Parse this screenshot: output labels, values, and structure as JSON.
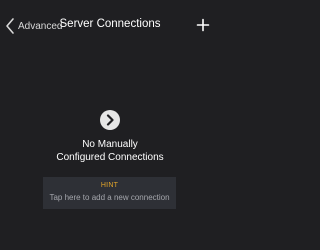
{
  "navbar": {
    "back_label": "Advanced",
    "title": "Server Connections",
    "add_icon": "plus-icon",
    "back_icon": "chevron-left-icon"
  },
  "empty_state": {
    "icon": "chevron-right-circle-icon",
    "line1": "No Manually",
    "line2": "Configured Connections"
  },
  "hint": {
    "title": "HINT",
    "text": "Tap here to add a new connection"
  },
  "colors": {
    "background": "#1f1f22",
    "hint_background": "#2e3036",
    "hint_title": "#e2a52a",
    "hint_text": "#a5a7ad"
  }
}
